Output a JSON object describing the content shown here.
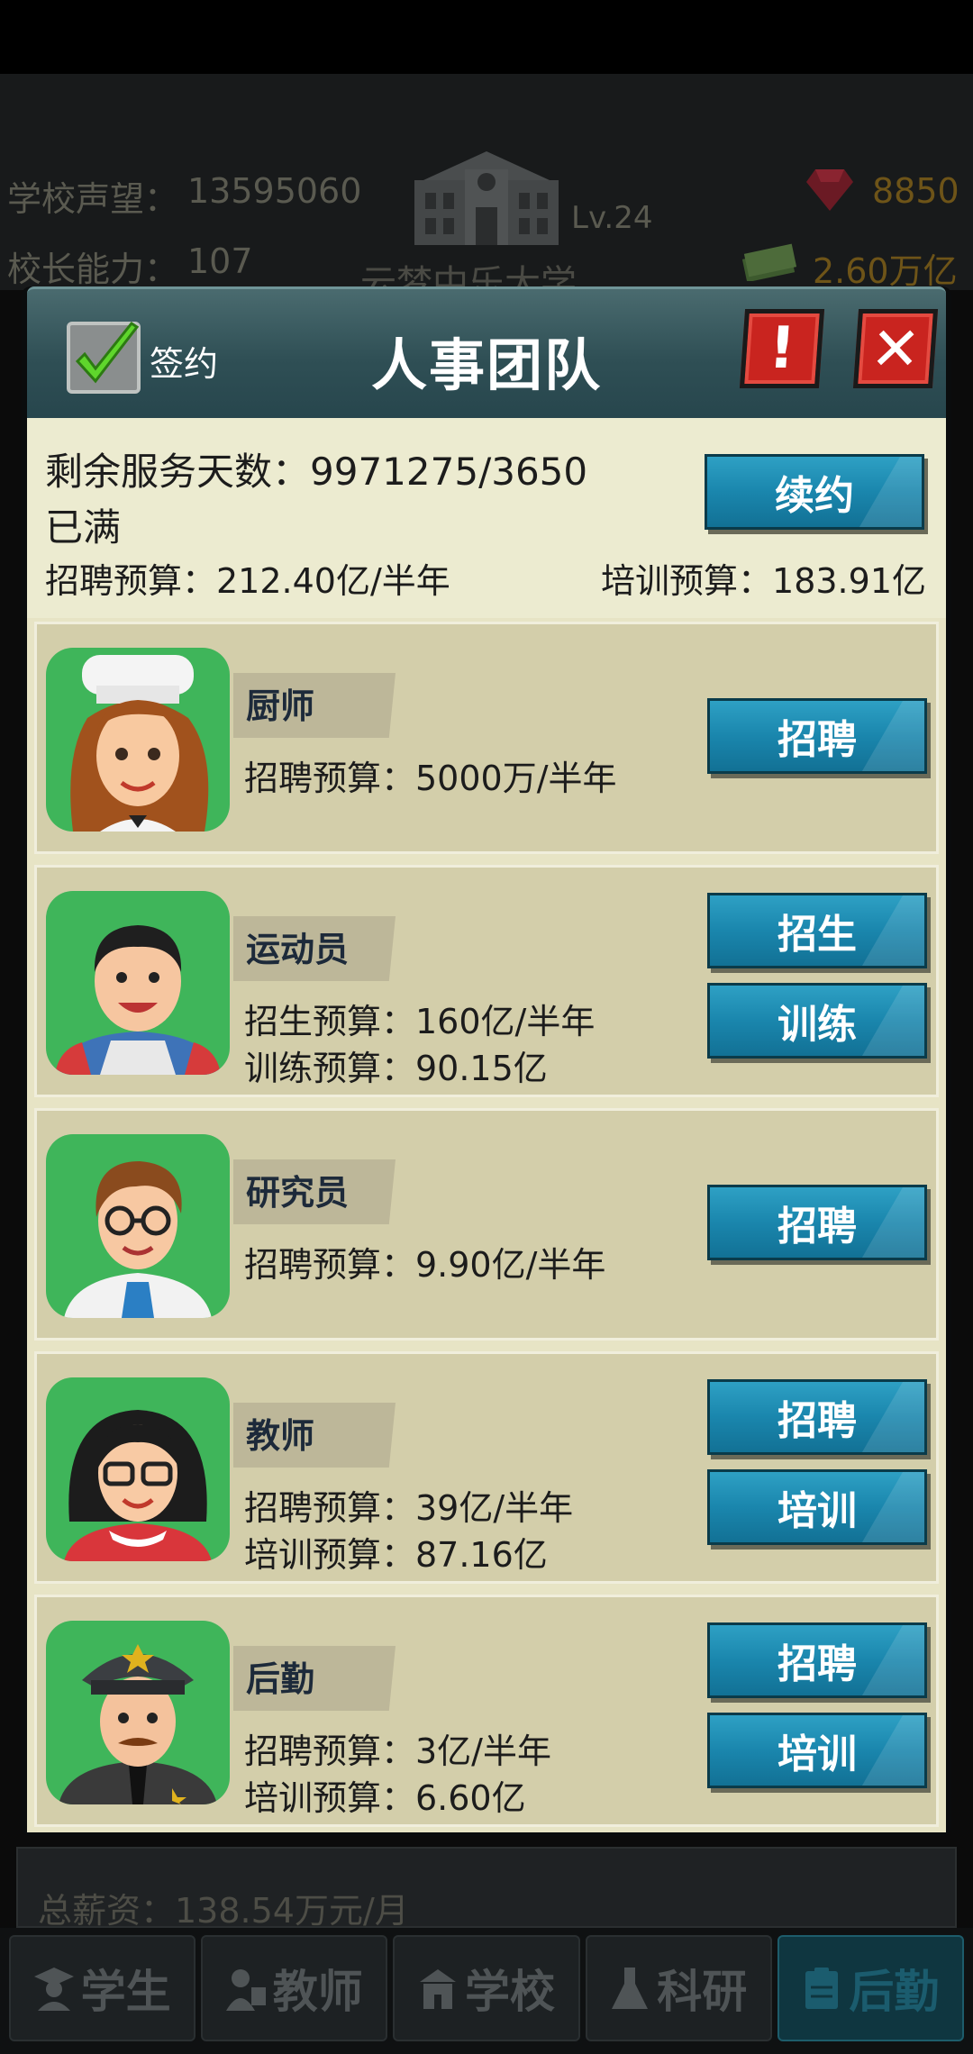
{
  "background": {
    "reputation_label": "学校声望：",
    "reputation_value": "13595060",
    "ability_label": "校长能力：",
    "ability_value": "107",
    "level": "Lv.24",
    "school_name": "云梦中乐大学",
    "gems": "8850",
    "money": "2.60万亿",
    "salary": "总薪资：138.54万元/月"
  },
  "dialog": {
    "title": "人事团队",
    "sign_label": "签约",
    "alert_symbol": "!",
    "close_symbol": "✕",
    "summary": {
      "days_label": "剩余服务天数：",
      "days_value": "9971275/3650",
      "status": "已满",
      "renew_label": "续约",
      "recruit_budget": "招聘预算：212.40亿/半年",
      "training_budget": "培训预算：183.91亿"
    },
    "roles": [
      {
        "name": "厨师",
        "line1": "招聘预算：5000万/半年",
        "line2": "",
        "button1": "招聘",
        "button2": ""
      },
      {
        "name": "运动员",
        "line1": "招生预算：160亿/半年",
        "line2": "训练预算：90.15亿",
        "button1": "招生",
        "button2": "训练"
      },
      {
        "name": "研究员",
        "line1": "招聘预算：9.90亿/半年",
        "line2": "",
        "button1": "招聘",
        "button2": ""
      },
      {
        "name": "教师",
        "line1": "招聘预算：39亿/半年",
        "line2": "培训预算：87.16亿",
        "button1": "招聘",
        "button2": "培训"
      },
      {
        "name": "后勤",
        "line1": "招聘预算：3亿/半年",
        "line2": "培训预算：6.60亿",
        "button1": "招聘",
        "button2": "培训"
      }
    ]
  },
  "nav": {
    "tabs": [
      {
        "label": "学生",
        "icon": "student-icon"
      },
      {
        "label": "教师",
        "icon": "teacher-icon"
      },
      {
        "label": "学校",
        "icon": "school-icon"
      },
      {
        "label": "科研",
        "icon": "flask-icon"
      },
      {
        "label": "后勤",
        "icon": "clipboard-icon"
      }
    ],
    "active": "后勤"
  },
  "colors": {
    "button_blue": "#1a86ad",
    "card_bg": "#d3ceaa",
    "header_teal": "#2f4f55",
    "danger_red": "#c9241f",
    "avatar_green": "#3fb55a"
  }
}
